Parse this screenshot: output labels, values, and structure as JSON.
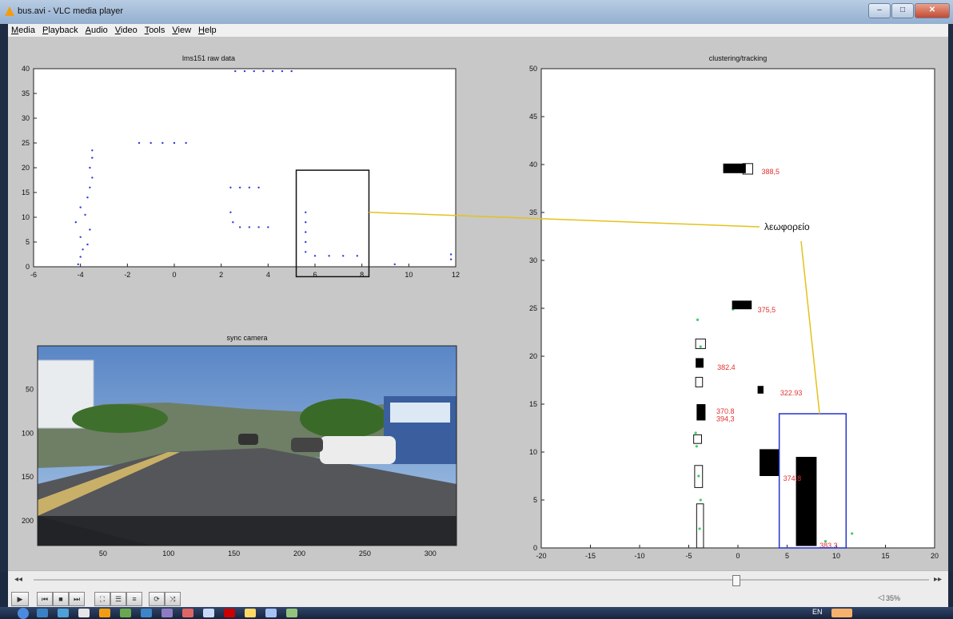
{
  "window": {
    "title": "bus.avi - VLC media player"
  },
  "menu": [
    "Media",
    "Playback",
    "Audio",
    "Video",
    "Tools",
    "View",
    "Help"
  ],
  "plots": {
    "raw": {
      "title": "lms151 raw data"
    },
    "camera": {
      "title": "sync camera"
    },
    "tracking": {
      "title": "clustering/tracking"
    }
  },
  "annotation": {
    "label": "λεωφορείο"
  },
  "player": {
    "seek_left": "◂◂",
    "seek_right": "▸▸",
    "position_fraction": 0.78,
    "volume_label": "35%"
  },
  "taskbar": {
    "language": "EN"
  },
  "colors": {
    "scan_points": "#2d3ddc",
    "highlight_box": "#2233cc",
    "annotation_line": "#e3c21c",
    "id_text": "#e23030",
    "green_marks": "#3cd06a"
  },
  "chart_data": [
    {
      "type": "scatter",
      "title": "lms151 raw data",
      "xlim": [
        -6,
        12
      ],
      "ylim": [
        0,
        40
      ],
      "xticks": [
        -6,
        -4,
        -2,
        0,
        2,
        4,
        6,
        8,
        10,
        12
      ],
      "yticks": [
        0,
        5,
        10,
        15,
        20,
        25,
        30,
        35,
        40
      ],
      "series": [
        {
          "values": [
            [
              -4.1,
              0.5
            ],
            [
              -4.0,
              2.0
            ],
            [
              -3.9,
              3.5
            ],
            [
              -3.7,
              4.5
            ],
            [
              -4.0,
              6.0
            ],
            [
              -3.6,
              7.5
            ],
            [
              -4.2,
              9.0
            ],
            [
              -3.8,
              10.5
            ],
            [
              -4.0,
              12.0
            ],
            [
              -3.7,
              14.0
            ],
            [
              -3.6,
              16.0
            ],
            [
              -3.5,
              18.0
            ],
            [
              -3.6,
              20.0
            ],
            [
              -3.5,
              22.0
            ],
            [
              -3.5,
              23.5
            ],
            [
              -1.5,
              25
            ],
            [
              -1.0,
              25
            ],
            [
              -0.5,
              25
            ],
            [
              0.0,
              25
            ],
            [
              0.5,
              25
            ],
            [
              2.4,
              16
            ],
            [
              2.8,
              16
            ],
            [
              3.2,
              16
            ],
            [
              3.6,
              16
            ],
            [
              2.4,
              11
            ],
            [
              2.5,
              9
            ],
            [
              2.8,
              8
            ],
            [
              3.2,
              8
            ],
            [
              3.6,
              8
            ],
            [
              4.0,
              8
            ],
            [
              5.6,
              11
            ],
            [
              5.6,
              9
            ],
            [
              5.6,
              7
            ],
            [
              5.6,
              5
            ],
            [
              5.6,
              3
            ],
            [
              6.0,
              2.2
            ],
            [
              6.6,
              2.2
            ],
            [
              7.2,
              2.2
            ],
            [
              7.8,
              2.2
            ],
            [
              2.6,
              39.5
            ],
            [
              3.0,
              39.5
            ],
            [
              3.4,
              39.5
            ],
            [
              3.8,
              39.5
            ],
            [
              4.2,
              39.5
            ],
            [
              4.6,
              39.5
            ],
            [
              5.0,
              39.5
            ],
            [
              9.4,
              0.5
            ],
            [
              11.8,
              1.5
            ],
            [
              11.8,
              2.5
            ]
          ]
        }
      ],
      "highlight_box": {
        "x": [
          5.2,
          8.3
        ],
        "y": [
          -2,
          19.5
        ]
      }
    },
    {
      "type": "image",
      "title": "sync camera",
      "xticks": [
        50,
        100,
        150,
        200,
        250,
        300
      ],
      "yticks": [
        50,
        100,
        150,
        200
      ]
    },
    {
      "type": "scatter",
      "title": "clustering/tracking",
      "xlim": [
        -20,
        20
      ],
      "ylim": [
        0,
        50
      ],
      "xticks": [
        -20,
        -15,
        -10,
        -5,
        0,
        5,
        10,
        15,
        20
      ],
      "yticks": [
        0,
        5,
        10,
        15,
        20,
        25,
        30,
        35,
        40,
        45,
        50
      ],
      "filled_boxes": [
        {
          "x": [
            -1.5,
            0.8
          ],
          "y": [
            39.1,
            40.1
          ]
        },
        {
          "x": [
            -0.6,
            1.4
          ],
          "y": [
            24.9,
            25.8
          ]
        },
        {
          "x": [
            -4.3,
            -3.5
          ],
          "y": [
            18.8,
            19.8
          ]
        },
        {
          "x": [
            -4.2,
            -3.3
          ],
          "y": [
            13.3,
            15.0
          ]
        },
        {
          "x": [
            2.2,
            4.2
          ],
          "y": [
            7.5,
            10.3
          ]
        },
        {
          "x": [
            2.0,
            2.6
          ],
          "y": [
            16.1,
            16.9
          ]
        },
        {
          "x": [
            5.9,
            8.0
          ],
          "y": [
            0.2,
            9.5
          ]
        }
      ],
      "outline_boxes": [
        {
          "x": [
            0.5,
            1.5
          ],
          "y": [
            39.0,
            40.1
          ]
        },
        {
          "x": [
            -4.3,
            -3.3
          ],
          "y": [
            20.8,
            21.8
          ]
        },
        {
          "x": [
            -4.3,
            -3.6
          ],
          "y": [
            16.8,
            17.8
          ]
        },
        {
          "x": [
            -4.5,
            -3.7
          ],
          "y": [
            10.9,
            11.8
          ]
        },
        {
          "x": [
            -4.4,
            -3.6
          ],
          "y": [
            6.3,
            8.6
          ]
        },
        {
          "x": [
            -4.2,
            -3.5
          ],
          "y": [
            0.0,
            4.6
          ]
        }
      ],
      "highlight_box": {
        "x": [
          4.2,
          11.0
        ],
        "y": [
          0.0,
          14.0
        ]
      },
      "id_labels": [
        {
          "text": "388,5",
          "x": 2.4,
          "y": 39.0
        },
        {
          "text": "375,5",
          "x": 2.0,
          "y": 24.6
        },
        {
          "text": "382.4",
          "x": -2.1,
          "y": 18.6
        },
        {
          "text": "322.93",
          "x": 4.3,
          "y": 15.9
        },
        {
          "text": "370.8",
          "x": -2.2,
          "y": 14.0
        },
        {
          "text": "394,3",
          "x": -2.2,
          "y": 13.2
        },
        {
          "text": "374.8",
          "x": 4.6,
          "y": 7.0
        },
        {
          "text": "383.3",
          "x": 8.3,
          "y": 0.0
        }
      ],
      "points": [
        [
          -4.1,
          23.8
        ],
        [
          -3.8,
          21.0
        ],
        [
          -0.5,
          24.9
        ],
        [
          -4.3,
          12.0
        ],
        [
          -4.2,
          10.6
        ],
        [
          -4.0,
          7.5
        ],
        [
          -3.9,
          2.0
        ],
        [
          -3.8,
          5.0
        ],
        [
          8.9,
          0.7
        ],
        [
          11.6,
          1.5
        ]
      ]
    }
  ]
}
